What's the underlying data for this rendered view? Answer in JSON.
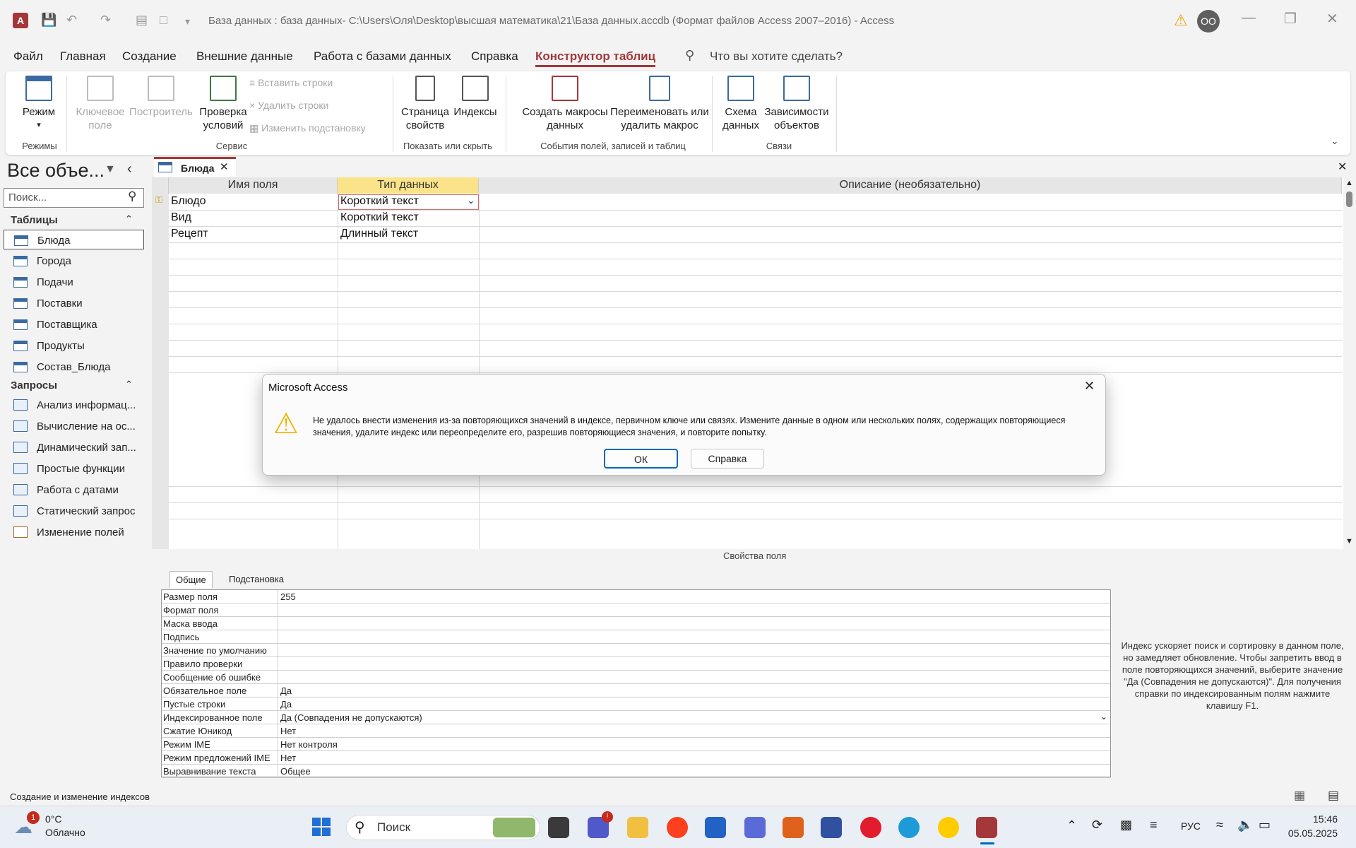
{
  "window": {
    "title": "База данных : база данных- C:\\Users\\Оля\\Desktop\\высшая математика\\21\\База данных.accdb (Формат файлов Access 2007–2016)  -  Access",
    "app_icon": "A",
    "user_initials": "OO"
  },
  "menu": {
    "items": [
      "Файл",
      "Главная",
      "Создание",
      "Внешние данные",
      "Работа с базами данных",
      "Справка",
      "Конструктор таблиц"
    ],
    "search_prompt": "Что вы хотите сделать?"
  },
  "ribbon": {
    "mode": "Режим",
    "key_field": "Ключевое поле",
    "builder": "Построитель",
    "check_conditions": "Проверка условий",
    "insert_rows": "Вставить строки",
    "delete_rows": "Удалить строки",
    "change_lookup": "Изменить подстановку",
    "property_sheet": "Страница свойств",
    "indexes": "Индексы",
    "create_macros": "Создать макросы данных",
    "rename_macro": "Переименовать или удалить макрос",
    "schema": "Схема данных",
    "dependencies": "Зависимости объектов",
    "groups": [
      "Режимы",
      "Сервис",
      "Показать или скрыть",
      "События полей, записей и таблиц",
      "Связи"
    ]
  },
  "nav": {
    "title": "Все объе...",
    "search_placeholder": "Поиск...",
    "tables_header": "Таблицы",
    "tables": [
      "Блюда",
      "Города",
      "Подачи",
      "Поставки",
      "Поставщика",
      "Продукты",
      "Состав_Блюда"
    ],
    "queries_header": "Запросы",
    "queries": [
      "Анализ информац...",
      "Вычисление на ос...",
      "Динамический зап...",
      "Простые функции",
      "Работа с датами",
      "Статический запрос",
      "Изменение полей"
    ]
  },
  "document": {
    "tab_label": "Блюда",
    "columns": [
      "Имя поля",
      "Тип данных",
      "Описание (необязательно)"
    ],
    "rows": [
      {
        "name": "Блюдо",
        "type": "Короткий текст"
      },
      {
        "name": "Вид",
        "type": "Короткий текст"
      },
      {
        "name": "Рецепт",
        "type": "Длинный текст"
      }
    ]
  },
  "properties": {
    "title": "Свойства поля",
    "tabs": [
      "Общие",
      "Подстановка"
    ],
    "rows": [
      {
        "label": "Размер поля",
        "value": "255"
      },
      {
        "label": "Формат поля",
        "value": ""
      },
      {
        "label": "Маска ввода",
        "value": ""
      },
      {
        "label": "Подпись",
        "value": ""
      },
      {
        "label": "Значение по умолчанию",
        "value": ""
      },
      {
        "label": "Правило проверки",
        "value": ""
      },
      {
        "label": "Сообщение об ошибке",
        "value": ""
      },
      {
        "label": "Обязательное поле",
        "value": "Да"
      },
      {
        "label": "Пустые строки",
        "value": "Да"
      },
      {
        "label": "Индексированное поле",
        "value": "Да (Совпадения не допускаются)"
      },
      {
        "label": "Сжатие Юникод",
        "value": "Нет"
      },
      {
        "label": "Режим IME",
        "value": "Нет контроля"
      },
      {
        "label": "Режим предложений IME",
        "value": "Нет"
      },
      {
        "label": "Выравнивание текста",
        "value": "Общее"
      }
    ],
    "help_text": "Индекс ускоряет поиск и сортировку в данном поле, но замедляет обновление. Чтобы запретить ввод в поле повторяющихся значений, выберите значение \"Да (Совпадения не допускаются)\". Для получения справки по индексированным полям нажмите клавишу F1."
  },
  "status": {
    "text": "Создание и изменение индексов"
  },
  "dialog": {
    "title": "Microsoft Access",
    "message": "Не удалось внести изменения из-за повторяющихся значений в индексе, первичном ключе или связях. Измените данные в одном или нескольких полях, содержащих повторяющиеся значения, удалите индекс или переопределите его, разрешив повторяющиеся значения, и повторите попытку.",
    "ok": "ОК",
    "help": "Справка"
  },
  "taskbar": {
    "weather_temp": "0°C",
    "weather_desc": "Облачно",
    "weather_badge": "1",
    "search": "Поиск",
    "lang": "РУС",
    "time": "15:46",
    "date": "05.05.2025"
  }
}
